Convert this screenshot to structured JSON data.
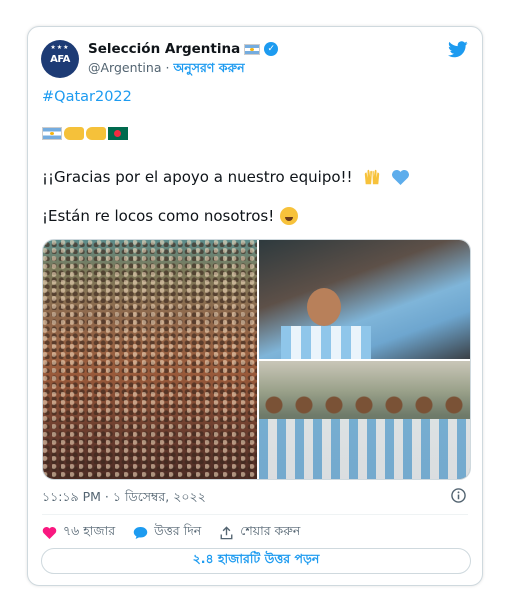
{
  "tweet": {
    "author": {
      "display_name": "Selección Argentina",
      "handle": "@Argentina",
      "separator": "·",
      "follow_label": "অনুসরণ করুন",
      "avatar_text": "AFA",
      "avatar_stars": "★★★"
    },
    "hashtag": "#Qatar2022",
    "text_line1": "¡¡Gracias por el apoyo a nuestro equipo!!",
    "text_line2": "¡Están re locos como nosotros!",
    "timestamp": "১১:১৯ PM · ১ ডিসেম্বর, ২০২২",
    "actions": {
      "like_count": "৭৬ হাজার",
      "reply_label": "উত্তর দিন",
      "share_label": "শেয়ার করুন"
    },
    "read_replies_label": "২.৪ হাজারটি উত্তর পড়ন"
  },
  "icons": {
    "brand": "twitter-icon",
    "verified": "verified-badge-icon",
    "like": "heart-icon",
    "reply": "reply-bubble-icon",
    "share": "share-icon",
    "info": "info-icon"
  },
  "colors": {
    "accent": "#1d9bf0",
    "like": "#f91880",
    "muted_text": "#536471",
    "border": "#cfd9de"
  }
}
